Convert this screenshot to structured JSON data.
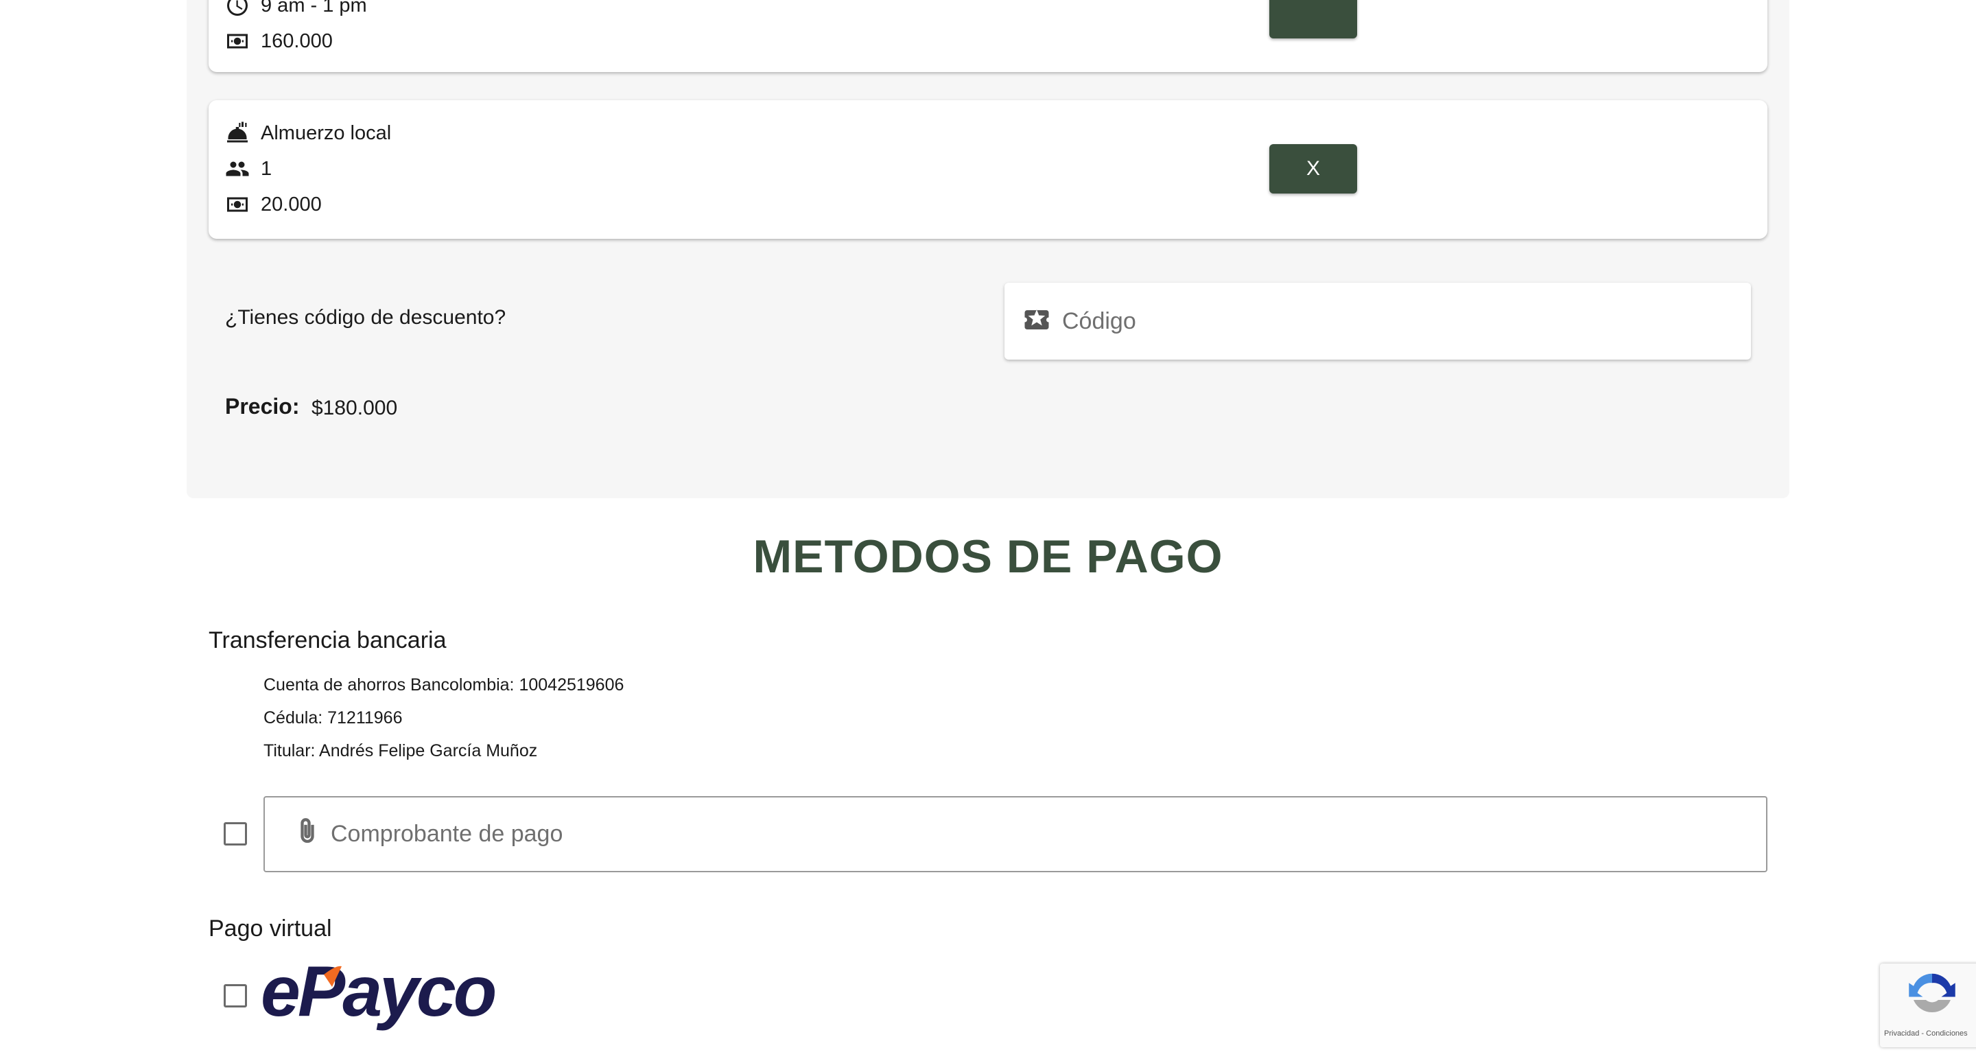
{
  "cards": [
    {
      "time": "9 am - 1 pm",
      "price": "160.000",
      "button_label": ""
    },
    {
      "name": "Almuerzo local",
      "quantity": "1",
      "price": "20.000",
      "button_label": "X"
    }
  ],
  "discount": {
    "label": "¿Tienes código de descuento?",
    "placeholder": "Código"
  },
  "price": {
    "label": "Precio:",
    "value": "$180.000"
  },
  "payment": {
    "title": "METODOS DE PAGO",
    "bank": {
      "title": "Transferencia bancaria",
      "account": "Cuenta de ahorros Bancolombia: 10042519606",
      "id": "Cédula: 71211966",
      "holder": "Titular: Andrés Felipe García Muñoz",
      "receipt_placeholder": "Comprobante de pago"
    },
    "virtual": {
      "title": "Pago virtual",
      "provider_logo": "ePayco"
    }
  },
  "recaptcha": {
    "links": "Privacidad - Condiciones"
  },
  "colors": {
    "accent": "#3a4f3d",
    "epayco_navy": "#1c1b4d",
    "epayco_orange": "#f26a21"
  }
}
